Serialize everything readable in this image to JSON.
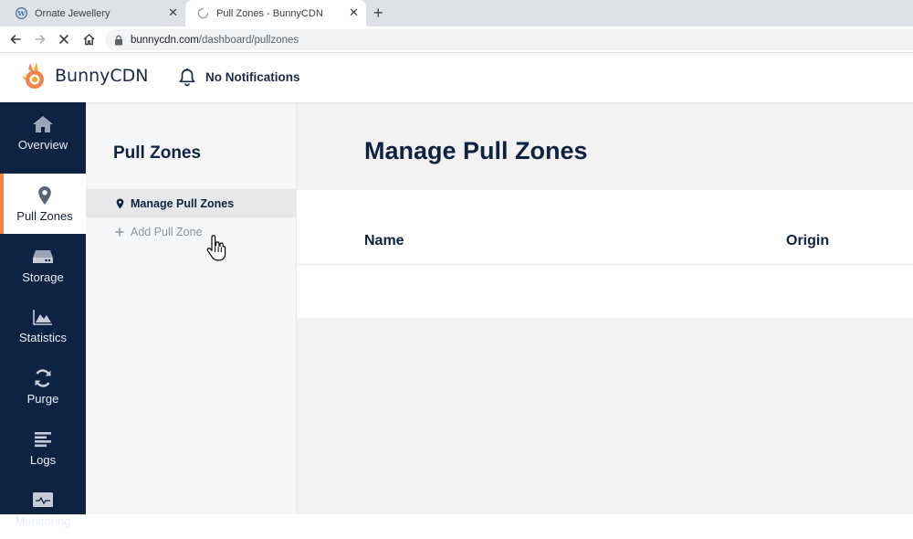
{
  "browser": {
    "tabs": [
      {
        "title": "Ornate Jewellery",
        "active": false
      },
      {
        "title": "Pull Zones - BunnyCDN",
        "active": true
      }
    ],
    "url_domain": "bunnycdn.com",
    "url_path": "/dashboard/pullzones"
  },
  "header": {
    "brand": "BunnyCDN",
    "notifications": "No Notifications",
    "brand_color": "#f2844a"
  },
  "leftnav": {
    "items": [
      {
        "label": "Overview",
        "icon": "home-icon",
        "active": false
      },
      {
        "label": "Pull Zones",
        "icon": "location-pin-icon",
        "active": true
      },
      {
        "label": "Storage",
        "icon": "storage-drive-icon",
        "active": false
      },
      {
        "label": "Statistics",
        "icon": "area-chart-icon",
        "active": false
      },
      {
        "label": "Purge",
        "icon": "refresh-icon",
        "active": false
      },
      {
        "label": "Logs",
        "icon": "list-icon",
        "active": false
      },
      {
        "label": "Monitoring",
        "icon": "monitor-icon",
        "active": false
      }
    ],
    "background": "#0e2241",
    "accent": "#f2844a"
  },
  "subnav": {
    "title": "Pull Zones",
    "items": [
      {
        "label": "Manage Pull Zones",
        "icon": "location-pin-icon",
        "active": true
      },
      {
        "label": "Add Pull Zone",
        "icon": "plus-icon",
        "active": false
      }
    ]
  },
  "main": {
    "title": "Manage Pull Zones",
    "table": {
      "columns": [
        "Name",
        "Origin"
      ],
      "rows": []
    }
  }
}
